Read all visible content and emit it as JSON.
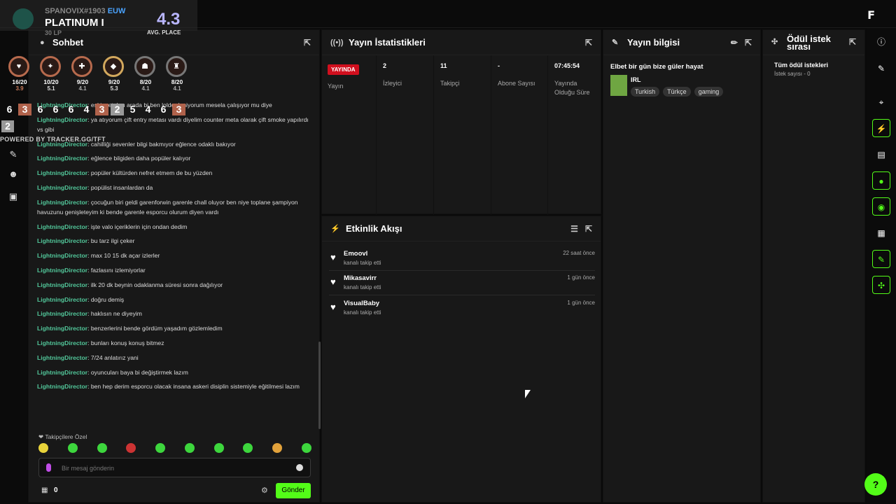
{
  "topbar": {
    "logo": "F"
  },
  "overlay": {
    "name_prefix": "SPANOVIX#1903",
    "region": "EUW",
    "rank": "PLATINUM I",
    "lp": "30 LP",
    "avg_value": "4.3",
    "avg_label": "AVG. PLACE",
    "champions": [
      {
        "placement": "16/20",
        "avg": "3.9"
      },
      {
        "placement": "10/20",
        "avg": "5.1"
      },
      {
        "placement": "9/20",
        "avg": "4.1"
      },
      {
        "placement": "9/20",
        "avg": "5.3"
      },
      {
        "placement": "8/20",
        "avg": "4.1"
      },
      {
        "placement": "8/20",
        "avg": "4.1"
      }
    ],
    "places": [
      "6",
      "3",
      "6",
      "6",
      "6",
      "4",
      "3",
      "2",
      "5",
      "4",
      "6",
      "3"
    ],
    "places_row2": "2",
    "powered": "POWERED BY TRACKER.GG/TFT"
  },
  "chat": {
    "title": "Sohbet",
    "messages": [
      {
        "user": "LightningDirector",
        "text": "eski metaları arada bi ben lolde deniyorum mesela çalışıyor mu diye"
      },
      {
        "user": "LightningDirector",
        "text": "ya atıyorum çift entry metası vardı diyelim counter meta olarak çift smoke yapılırdı vs gibi"
      },
      {
        "user": "LightningDirector",
        "text": "cahilliği sevenler bilgi bakmıyor eğlence odaklı bakıyor"
      },
      {
        "user": "LightningDirector",
        "text": "eğlence bilgiden daha popüler kalıyor"
      },
      {
        "user": "LightningDirector",
        "text": "popüler kültürden nefret etmem de bu yüzden"
      },
      {
        "user": "LightningDirector",
        "text": "popülist insanlardan da"
      },
      {
        "user": "LightningDirector",
        "text": "çocuğun biri geldi garenforwin garenle chall oluyor ben niye toplane şampiyon havuzunu genişleteyim ki bende garenle esporcu olurum diyen vardı"
      },
      {
        "user": "LightningDirector",
        "text": "işte valo içeriklerin için ondan dedim"
      },
      {
        "user": "LightningDirector",
        "text": "bu tarz ilgi çeker"
      },
      {
        "user": "LightningDirector",
        "text": "max 10 15 dk açar izlerler"
      },
      {
        "user": "LightningDirector",
        "text": "fazlasını izlemiyorlar"
      },
      {
        "user": "LightningDirector",
        "text": "ilk 20 dk beynin odaklanma süresi sonra dağılıyor"
      },
      {
        "user": "LightningDirector",
        "text": "doğru demiş"
      },
      {
        "user": "LightningDirector",
        "text": "haklısın ne diyeyim"
      },
      {
        "user": "LightningDirector",
        "text": "benzerlerini bende gördüm yaşadım gözlemledim"
      },
      {
        "user": "LightningDirector",
        "text": "bunları konuş konuş bitmez"
      },
      {
        "user": "LightningDirector",
        "text": "7/24 anlatırız yani"
      },
      {
        "user": "LightningDirector",
        "text": "oyuncuları baya bi değiştirmek lazım"
      },
      {
        "user": "LightningDirector",
        "text": "ben hep derim esporcu olacak insana askeri disiplin sistemiyle eğitilmesi lazım"
      }
    ],
    "followers_only": "Takipçilere Özel",
    "input_placeholder": "Bir mesaj gönderin",
    "points": "0",
    "send_label": "Gönder"
  },
  "stats": {
    "title": "Yayın İstatistikleri",
    "live_badge": "YAYINDA",
    "items": [
      {
        "value": "",
        "label": "Yayın"
      },
      {
        "value": "2",
        "label": "İzleyici"
      },
      {
        "value": "11",
        "label": "Takipçi"
      },
      {
        "value": "-",
        "label": "Abone Sayısı"
      },
      {
        "value": "07:45:54",
        "label": "Yayında Olduğu Süre"
      }
    ]
  },
  "activity": {
    "title": "Etkinlik Akışı",
    "items": [
      {
        "name": "Emoovl",
        "sub": "kanalı takip etti",
        "time": "22 saat önce"
      },
      {
        "name": "Mikasavirr",
        "sub": "kanalı takip etti",
        "time": "1 gün önce"
      },
      {
        "name": "VisualBaby",
        "sub": "kanalı takip etti",
        "time": "1 gün önce"
      }
    ]
  },
  "info": {
    "title": "Yayın bilgisi",
    "stream_title": "Elbet bir gün bize güler hayat",
    "category": "IRL",
    "tags": [
      "Turkish",
      "Türkçe",
      "gaming"
    ]
  },
  "rewards": {
    "title": "Ödül istek sırası",
    "all": "Tüm ödül istekleri",
    "count": "İstek sayısı - 0"
  }
}
